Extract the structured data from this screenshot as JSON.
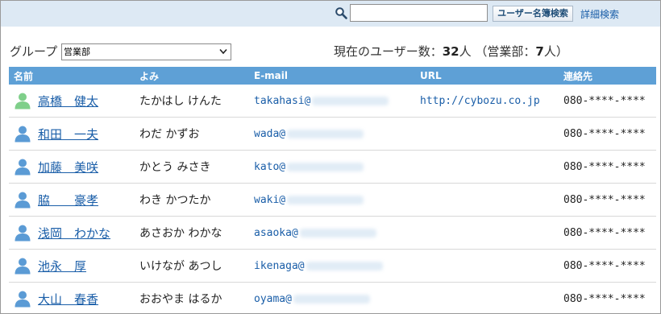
{
  "topbar": {
    "search_value": "",
    "search_button_label": "ユーザー名簿検索",
    "advanced_search_label": "詳細検索"
  },
  "group_filter": {
    "label": "グループ",
    "selected": "営業部"
  },
  "summary": {
    "prefix": "現在のユーザー数：",
    "total": "32",
    "unit": "人",
    "group_open": "（営業部：",
    "group_count": "7",
    "group_close": "人）"
  },
  "table": {
    "headers": {
      "name": "名前",
      "reading": "よみ",
      "email": "E-mail",
      "url": "URL",
      "contact": "連絡先"
    },
    "rows": [
      {
        "name": "高橋　健太",
        "reading": "たかはし けんた",
        "email_user": "takahasi@",
        "url": "http://cybozu.co.jp",
        "contact": "080-****-****",
        "avatar_color": "#7fcf8a"
      },
      {
        "name": "和田　一夫",
        "reading": "わだ かずお",
        "email_user": "wada@",
        "url": "",
        "contact": "080-****-****",
        "avatar_color": "#5b9bd5"
      },
      {
        "name": "加藤　美咲",
        "reading": "かとう みさき",
        "email_user": "kato@",
        "url": "",
        "contact": "080-****-****",
        "avatar_color": "#5b9bd5"
      },
      {
        "name": "脇　　豪孝",
        "reading": "わき かつたか",
        "email_user": "waki@",
        "url": "",
        "contact": "080-****-****",
        "avatar_color": "#5b9bd5"
      },
      {
        "name": "浅岡　わかな",
        "reading": "あさおか わかな",
        "email_user": "asaoka@",
        "url": "",
        "contact": "080-****-****",
        "avatar_color": "#5b9bd5"
      },
      {
        "name": "池永　厚",
        "reading": "いけなが あつし",
        "email_user": "ikenaga@",
        "url": "",
        "contact": "080-****-****",
        "avatar_color": "#5b9bd5"
      },
      {
        "name": "大山　春香",
        "reading": "おおやま はるか",
        "email_user": "oyama@",
        "url": "",
        "contact": "080-****-****",
        "avatar_color": "#5b9bd5"
      }
    ]
  }
}
